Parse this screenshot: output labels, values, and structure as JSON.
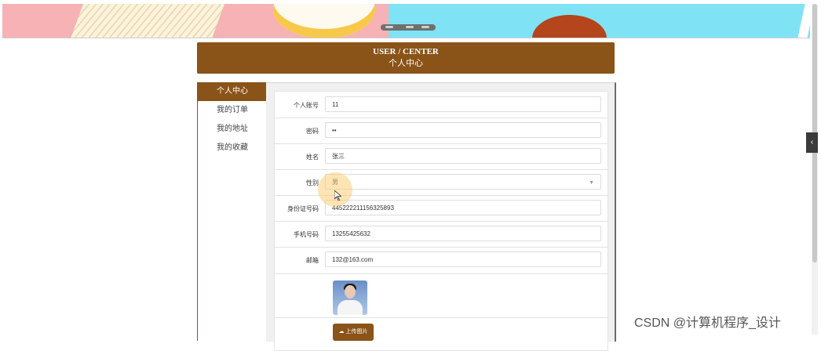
{
  "header": {
    "title_en": "USER / CENTER",
    "title_zh": "个人中心"
  },
  "sidebar": {
    "items": [
      {
        "label": "个人中心",
        "active": true
      },
      {
        "label": "我的订单"
      },
      {
        "label": "我的地址"
      },
      {
        "label": "我的收藏"
      }
    ]
  },
  "form": {
    "account": {
      "label": "个人账号",
      "value": "11"
    },
    "password": {
      "label": "密码",
      "value": "••"
    },
    "name": {
      "label": "姓名",
      "value": "张三"
    },
    "gender": {
      "label": "性别",
      "value": "男"
    },
    "id_number": {
      "label": "身份证号码",
      "value": "445222211156325893"
    },
    "phone": {
      "label": "手机号码",
      "value": "13255425632"
    },
    "email": {
      "label": "邮箱",
      "value": "132@163.com"
    },
    "upload_label": "上传图片"
  },
  "watermark": "CSDN @计算机程序_设计",
  "colors": {
    "accent": "#8a5318"
  },
  "icons": {
    "gender_select": "chevron-down-icon",
    "upload": "cloud-upload-icon",
    "side_tab": "chevron-left-icon"
  }
}
